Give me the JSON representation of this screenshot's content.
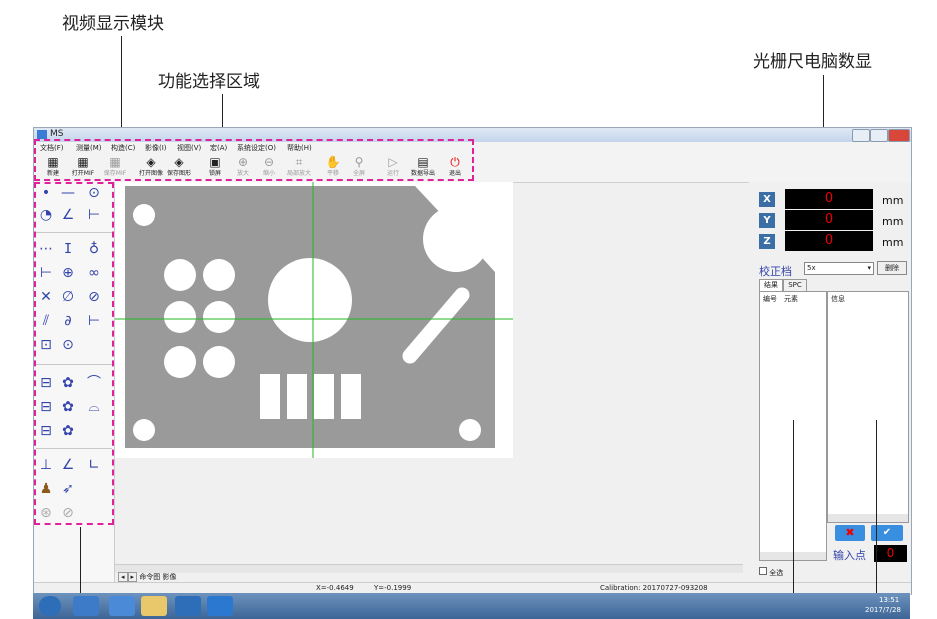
{
  "annotations": {
    "video_display": "视频显示模块",
    "function_area": "功能选择区域",
    "dro": "光栅尺电脑数显"
  },
  "window": {
    "title": "MS"
  },
  "menu": [
    "文档(F)",
    "测量(M)",
    "构造(C)",
    "影像(I)",
    "视图(V)",
    "宏(A)",
    "系统设定(O)",
    "帮助(H)"
  ],
  "toolbar": [
    {
      "label": "新建",
      "icon": "new-file-icon",
      "glyph": "▦",
      "enabled": true
    },
    {
      "label": "打开MIF",
      "icon": "open-mif-icon",
      "glyph": "▦",
      "enabled": true
    },
    {
      "label": "保存MIF",
      "icon": "save-mif-icon",
      "glyph": "▦",
      "enabled": false
    },
    {
      "label": "打开图像",
      "icon": "open-image-icon",
      "glyph": "◈",
      "enabled": true
    },
    {
      "label": "保存图形",
      "icon": "save-shape-icon",
      "glyph": "◈",
      "enabled": true
    },
    {
      "label": "锁屏",
      "icon": "lock-screen-icon",
      "glyph": "▣",
      "enabled": true
    },
    {
      "label": "放大",
      "icon": "zoom-in-icon",
      "glyph": "⊕",
      "enabled": false
    },
    {
      "label": "缩小",
      "icon": "zoom-out-icon",
      "glyph": "⊖",
      "enabled": false
    },
    {
      "label": "局部放大",
      "icon": "zoom-area-icon",
      "glyph": "⌗",
      "enabled": false
    },
    {
      "label": "平移",
      "icon": "pan-icon",
      "glyph": "✋",
      "enabled": false
    },
    {
      "label": "全屏",
      "icon": "fullscreen-icon",
      "glyph": "⚲",
      "enabled": false
    },
    {
      "label": "运行",
      "icon": "run-icon",
      "glyph": "▷",
      "enabled": false
    },
    {
      "label": "数据导出",
      "icon": "export-data-icon",
      "glyph": "▤",
      "enabled": true
    },
    {
      "label": "退出",
      "icon": "power-icon",
      "glyph": "⏻",
      "enabled": true
    }
  ],
  "dro": {
    "axes": [
      {
        "name": "X",
        "value": "0",
        "unit": "mm"
      },
      {
        "name": "Y",
        "value": "0",
        "unit": "mm"
      },
      {
        "name": "Z",
        "value": "0",
        "unit": "mm"
      }
    ],
    "calib_label": "校正档",
    "calib_value": "5x",
    "delete_label": "删除"
  },
  "tabs": [
    "结果",
    "SPC"
  ],
  "columns": {
    "number": "编号",
    "element": "元素",
    "info": "信息"
  },
  "input_point_label": "输入点",
  "input_point_value": "0",
  "select_all_label": "全选",
  "view_tabs": [
    "命令图",
    "影像"
  ],
  "status": {
    "x": "X=-0.4649",
    "y": "Y=-0.1999",
    "calibration": "Calibration: 20170727-093208"
  },
  "tray": {
    "time": "13:51",
    "date": "2017/7/28"
  },
  "colors": {
    "accent": "#3a6ea5",
    "highlight": "#e0219a",
    "display_text": "#ee0000",
    "crosshair": "#22bb22",
    "part": "#9a9a9a"
  }
}
